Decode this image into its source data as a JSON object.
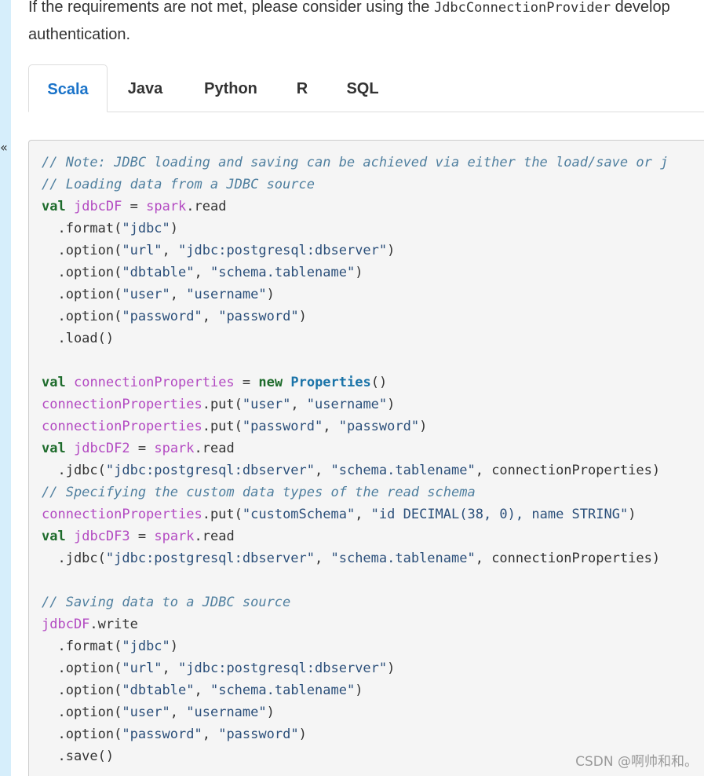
{
  "intro": {
    "line1_before": "If the requirements are not met, please consider using the ",
    "line1_code": "JdbcConnectionProvider",
    "line1_after": " develop",
    "line2": "authentication."
  },
  "tabs": [
    {
      "label": "Scala",
      "active": true
    },
    {
      "label": "Java",
      "active": false
    },
    {
      "label": "Python",
      "active": false
    },
    {
      "label": "R",
      "active": false
    },
    {
      "label": "SQL",
      "active": false
    }
  ],
  "sidebar": {
    "toggle_glyph": "«"
  },
  "code_lines": [
    [
      [
        "comment",
        "// Note: JDBC loading and saving can be achieved via either the load/save or j"
      ]
    ],
    [
      [
        "comment",
        "// Loading data from a JDBC source"
      ]
    ],
    [
      [
        "kw",
        "val"
      ],
      [
        "plain",
        " "
      ],
      [
        "var",
        "jdbcDF"
      ],
      [
        "plain",
        " = "
      ],
      [
        "var",
        "spark"
      ],
      [
        "plain",
        ".read"
      ]
    ],
    [
      [
        "plain",
        "  .format("
      ],
      [
        "str",
        "\"jdbc\""
      ],
      [
        "plain",
        ")"
      ]
    ],
    [
      [
        "plain",
        "  .option("
      ],
      [
        "str",
        "\"url\""
      ],
      [
        "plain",
        ", "
      ],
      [
        "str",
        "\"jdbc:postgresql:dbserver\""
      ],
      [
        "plain",
        ")"
      ]
    ],
    [
      [
        "plain",
        "  .option("
      ],
      [
        "str",
        "\"dbtable\""
      ],
      [
        "plain",
        ", "
      ],
      [
        "str",
        "\"schema.tablename\""
      ],
      [
        "plain",
        ")"
      ]
    ],
    [
      [
        "plain",
        "  .option("
      ],
      [
        "str",
        "\"user\""
      ],
      [
        "plain",
        ", "
      ],
      [
        "str",
        "\"username\""
      ],
      [
        "plain",
        ")"
      ]
    ],
    [
      [
        "plain",
        "  .option("
      ],
      [
        "str",
        "\"password\""
      ],
      [
        "plain",
        ", "
      ],
      [
        "str",
        "\"password\""
      ],
      [
        "plain",
        ")"
      ]
    ],
    [
      [
        "plain",
        "  .load()"
      ]
    ],
    [],
    [
      [
        "kw",
        "val"
      ],
      [
        "plain",
        " "
      ],
      [
        "var",
        "connectionProperties"
      ],
      [
        "plain",
        " = "
      ],
      [
        "kw",
        "new"
      ],
      [
        "plain",
        " "
      ],
      [
        "type",
        "Properties"
      ],
      [
        "plain",
        "()"
      ]
    ],
    [
      [
        "var",
        "connectionProperties"
      ],
      [
        "plain",
        ".put("
      ],
      [
        "str",
        "\"user\""
      ],
      [
        "plain",
        ", "
      ],
      [
        "str",
        "\"username\""
      ],
      [
        "plain",
        ")"
      ]
    ],
    [
      [
        "var",
        "connectionProperties"
      ],
      [
        "plain",
        ".put("
      ],
      [
        "str",
        "\"password\""
      ],
      [
        "plain",
        ", "
      ],
      [
        "str",
        "\"password\""
      ],
      [
        "plain",
        ")"
      ]
    ],
    [
      [
        "kw",
        "val"
      ],
      [
        "plain",
        " "
      ],
      [
        "var",
        "jdbcDF2"
      ],
      [
        "plain",
        " = "
      ],
      [
        "var",
        "spark"
      ],
      [
        "plain",
        ".read"
      ]
    ],
    [
      [
        "plain",
        "  .jdbc("
      ],
      [
        "str",
        "\"jdbc:postgresql:dbserver\""
      ],
      [
        "plain",
        ", "
      ],
      [
        "str",
        "\"schema.tablename\""
      ],
      [
        "plain",
        ", connectionProperties)"
      ]
    ],
    [
      [
        "comment",
        "// Specifying the custom data types of the read schema"
      ]
    ],
    [
      [
        "var",
        "connectionProperties"
      ],
      [
        "plain",
        ".put("
      ],
      [
        "str",
        "\"customSchema\""
      ],
      [
        "plain",
        ", "
      ],
      [
        "str",
        "\"id DECIMAL(38, 0), name STRING\""
      ],
      [
        "plain",
        ")"
      ]
    ],
    [
      [
        "kw",
        "val"
      ],
      [
        "plain",
        " "
      ],
      [
        "var",
        "jdbcDF3"
      ],
      [
        "plain",
        " = "
      ],
      [
        "var",
        "spark"
      ],
      [
        "plain",
        ".read"
      ]
    ],
    [
      [
        "plain",
        "  .jdbc("
      ],
      [
        "str",
        "\"jdbc:postgresql:dbserver\""
      ],
      [
        "plain",
        ", "
      ],
      [
        "str",
        "\"schema.tablename\""
      ],
      [
        "plain",
        ", connectionProperties)"
      ]
    ],
    [],
    [
      [
        "comment",
        "// Saving data to a JDBC source"
      ]
    ],
    [
      [
        "var",
        "jdbcDF"
      ],
      [
        "plain",
        ".write"
      ]
    ],
    [
      [
        "plain",
        "  .format("
      ],
      [
        "str",
        "\"jdbc\""
      ],
      [
        "plain",
        ")"
      ]
    ],
    [
      [
        "plain",
        "  .option("
      ],
      [
        "str",
        "\"url\""
      ],
      [
        "plain",
        ", "
      ],
      [
        "str",
        "\"jdbc:postgresql:dbserver\""
      ],
      [
        "plain",
        ")"
      ]
    ],
    [
      [
        "plain",
        "  .option("
      ],
      [
        "str",
        "\"dbtable\""
      ],
      [
        "plain",
        ", "
      ],
      [
        "str",
        "\"schema.tablename\""
      ],
      [
        "plain",
        ")"
      ]
    ],
    [
      [
        "plain",
        "  .option("
      ],
      [
        "str",
        "\"user\""
      ],
      [
        "plain",
        ", "
      ],
      [
        "str",
        "\"username\""
      ],
      [
        "plain",
        ")"
      ]
    ],
    [
      [
        "plain",
        "  .option("
      ],
      [
        "str",
        "\"password\""
      ],
      [
        "plain",
        ", "
      ],
      [
        "str",
        "\"password\""
      ],
      [
        "plain",
        ")"
      ]
    ],
    [
      [
        "plain",
        "  .save()"
      ]
    ]
  ],
  "watermark": "CSDN @啊帅和和。",
  "colors": {
    "tab_active": "#1a73c9",
    "comment": "#4f7f9f",
    "keyword": "#1d6b2b",
    "variable": "#b34ac2",
    "string": "#2b4f7a",
    "type": "#1a73a8",
    "code_bg": "#f5f5f5",
    "sidebar_bg": "#d6eefb"
  }
}
